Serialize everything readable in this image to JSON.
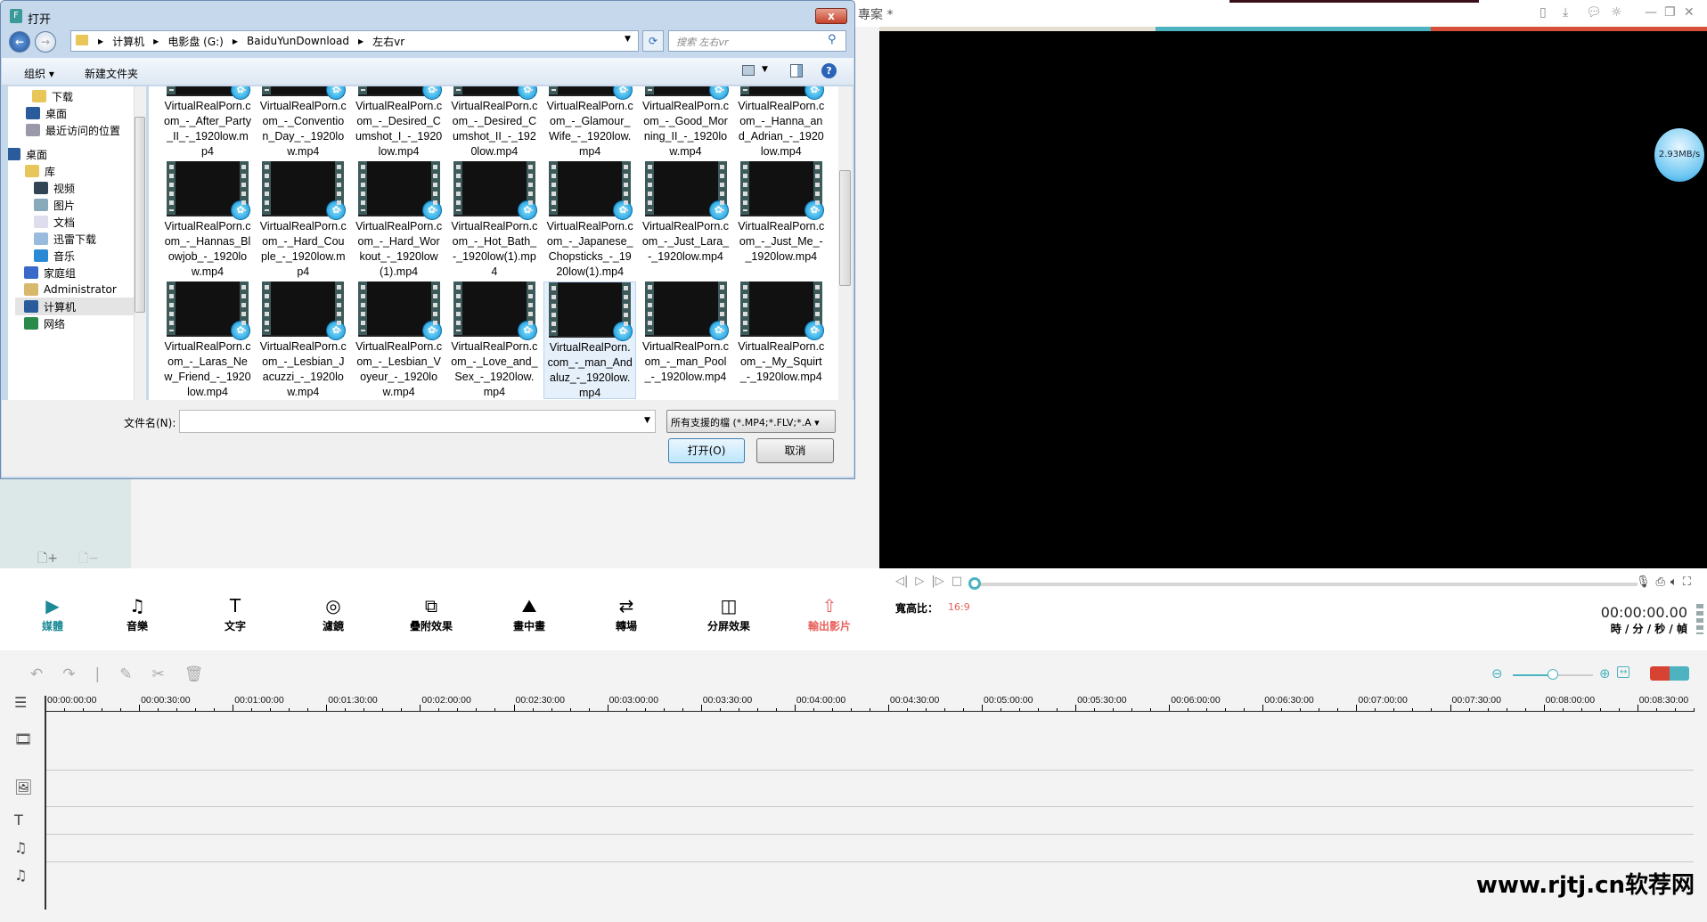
{
  "dialog": {
    "title": "打开",
    "close": "x",
    "address": [
      "计算机",
      "电影盘 (G:)",
      "BaiduYunDownload",
      "左右vr"
    ],
    "search_placeholder": "搜索 左右vr",
    "toolbar": {
      "organize": "组织 ▾",
      "new_folder": "新建文件夹",
      "help": "?"
    },
    "nav": [
      "下载",
      "桌面",
      "最近访问的位置",
      "桌面",
      "库",
      "视频",
      "图片",
      "文档",
      "迅雷下载",
      "音乐",
      "家庭组",
      "Administrator",
      "计算机",
      "网络"
    ],
    "files": [
      "VirtualRealPorn.com_-_After_Party_II_-_1920low.mp4",
      "VirtualRealPorn.com_-_Convention_Day_-_1920low.mp4",
      "VirtualRealPorn.com_-_Desired_Cumshot_I_-_1920low.mp4",
      "VirtualRealPorn.com_-_Desired_Cumshot_II_-_1920low.mp4",
      "VirtualRealPorn.com_-_Glamour_Wife_-_1920low.mp4",
      "VirtualRealPorn.com_-_Good_Morning_II_-_1920low.mp4",
      "VirtualRealPorn.com_-_Hanna_and_Adrian_-_1920low.mp4",
      "VirtualRealPorn.com_-_Hannas_Blowjob_-_1920low.mp4",
      "VirtualRealPorn.com_-_Hard_Couple_-_1920low.mp4",
      "VirtualRealPorn.com_-_Hard_Workout_-_1920low(1).mp4",
      "VirtualRealPorn.com_-_Hot_Bath_-_1920low(1).mp4",
      "VirtualRealPorn.com_-_Japanese_Chopsticks_-_1920low(1).mp4",
      "VirtualRealPorn.com_-_Just_Lara_-_1920low.mp4",
      "VirtualRealPorn.com_-_Just_Me_-_1920low.mp4",
      "VirtualRealPorn.com_-_Laras_New_Friend_-_1920low.mp4",
      "VirtualRealPorn.com_-_Lesbian_Jacuzzi_-_1920low.mp4",
      "VirtualRealPorn.com_-_Lesbian_Voyeur_-_1920low.mp4",
      "VirtualRealPorn.com_-_Love_and_Sex_-_1920low.mp4",
      "VirtualRealPorn.com_-_man_Andaluz_-_1920low.mp4",
      "VirtualRealPorn.com_-_man_Pool_-_1920low.mp4",
      "VirtualRealPorn.com_-_My_Squirt_-_1920low.mp4"
    ],
    "selected_index": 18,
    "filename_label": "文件名(N):",
    "filename_value": "",
    "filter": "所有支援的檔 (*.MP4;*.FLV;*.A",
    "open": "打开(O)",
    "cancel": "取消"
  },
  "app": {
    "project_title": "專案 *",
    "speed": "2.93MB/s",
    "colors": {
      "beige": "#e3dfd2",
      "teal": "#4db3c0",
      "red": "#d8503a",
      "accent_red": "#e8605a"
    },
    "media_tools": [
      "媒體",
      "音樂",
      "文字",
      "濾鏡",
      "疊附效果",
      "畫中畫",
      "轉場",
      "分屏效果",
      "輸出影片"
    ],
    "aspect_label": "寬高比：",
    "aspect_value": "16:9",
    "timecode": "00:00:00.00",
    "timecode_units": "時 / 分 / 秒 / 幀",
    "ruler": [
      "00:00:00:00",
      "00:00:30:00",
      "00:01:00:00",
      "00:01:30:00",
      "00:02:00:00",
      "00:02:30:00",
      "00:03:00:00",
      "00:03:30:00",
      "00:04:00:00",
      "00:04:30:00",
      "00:05:00:00",
      "00:05:30:00",
      "00:06:00:00",
      "00:06:30:00",
      "00:07:00:00",
      "00:07:30:00",
      "00:08:00:00",
      "00:08:30:00"
    ],
    "timeline_zoom": 0.5
  },
  "watermark": "www.rjtj.cn软荐网"
}
